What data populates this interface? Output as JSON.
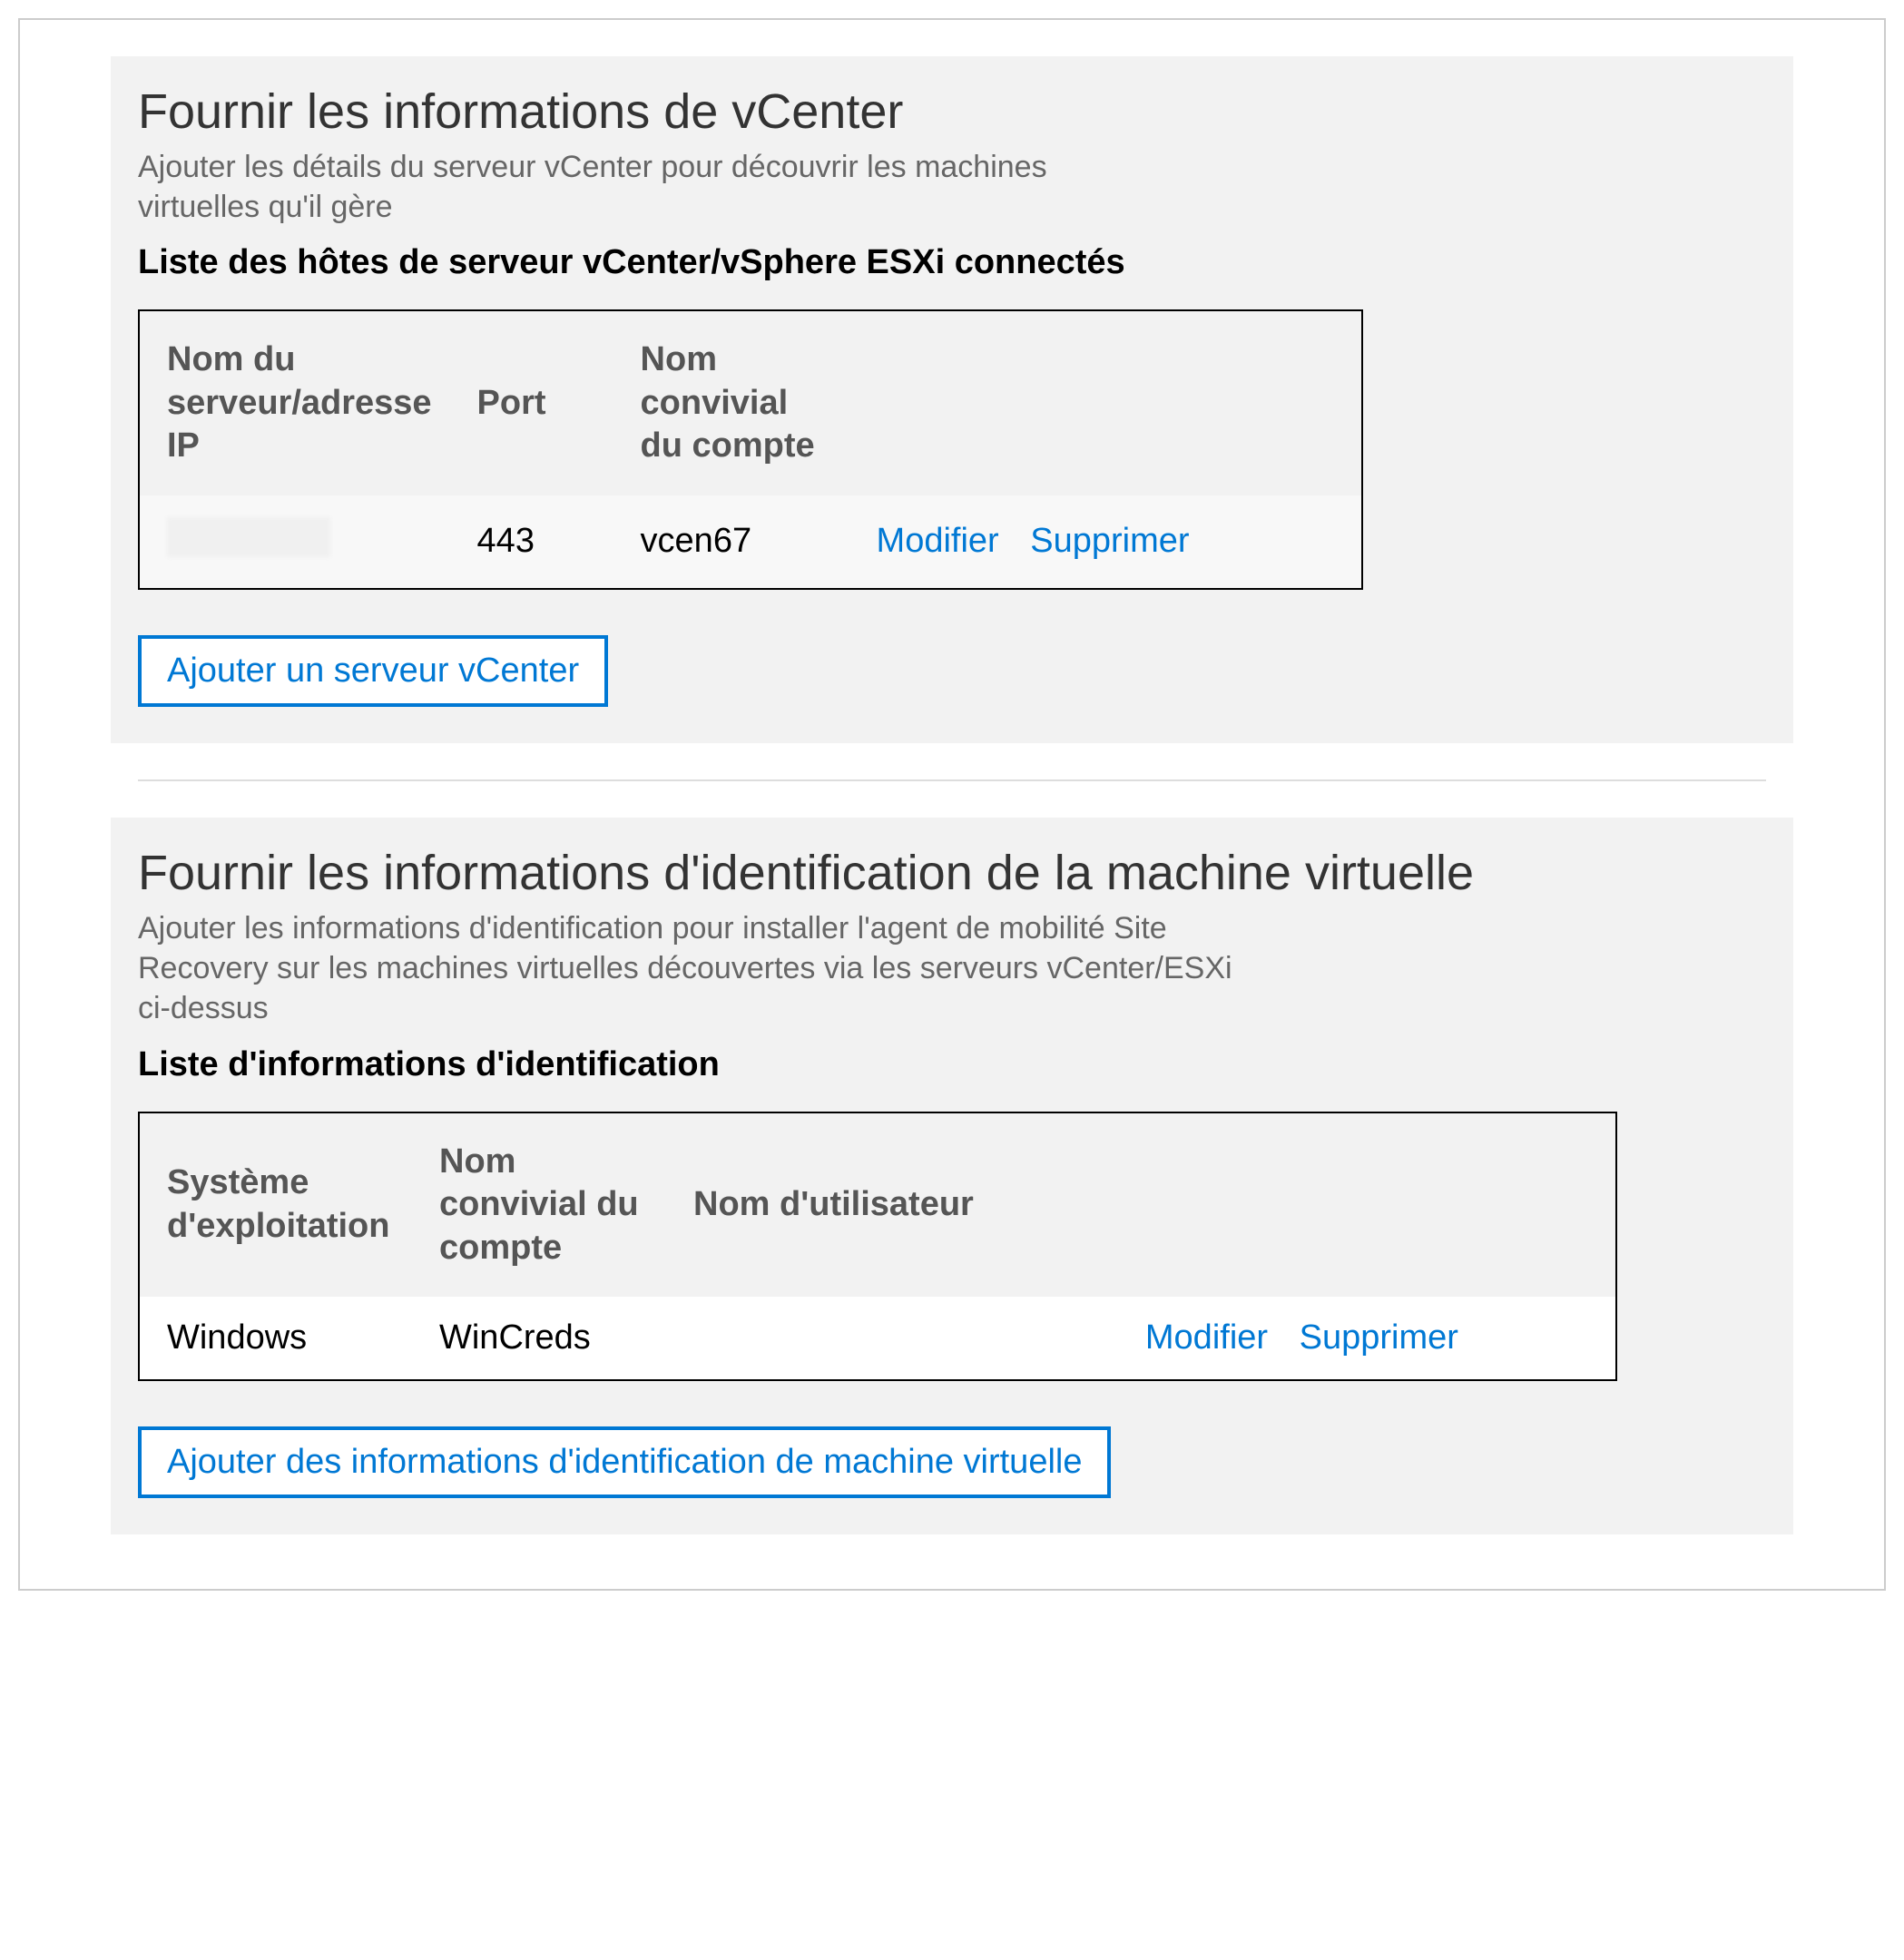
{
  "vcenter": {
    "title": "Fournir les informations de vCenter",
    "desc": "Ajouter les détails du serveur vCenter pour découvrir les machines virtuelles qu'il gère",
    "subtitle": "Liste des hôtes de serveur vCenter/vSphere ESXi connectés",
    "headers": {
      "server": "Nom du serveur/adresse IP",
      "port": "Port",
      "friendly": "Nom convivial du compte"
    },
    "rows": [
      {
        "server": "",
        "port": "443",
        "friendly": "vcen67"
      }
    ],
    "actions": {
      "edit": "Modifier",
      "delete": "Supprimer"
    },
    "add_btn": "Ajouter un serveur vCenter"
  },
  "creds": {
    "title": "Fournir les informations d'identification de la machine virtuelle",
    "desc": "Ajouter les informations d'identification pour installer l'agent de mobilité Site Recovery sur les machines virtuelles découvertes via les serveurs vCenter/ESXi ci-dessus",
    "subtitle": "Liste d'informations d'identification",
    "headers": {
      "os": "Système d'exploitation",
      "friendly": "Nom convivial du compte",
      "username": "Nom d'utilisateur"
    },
    "rows": [
      {
        "os": "Windows",
        "friendly": "WinCreds",
        "username": ""
      }
    ],
    "actions": {
      "edit": "Modifier",
      "delete": "Supprimer"
    },
    "add_btn": "Ajouter des informations d'identification de machine virtuelle"
  }
}
